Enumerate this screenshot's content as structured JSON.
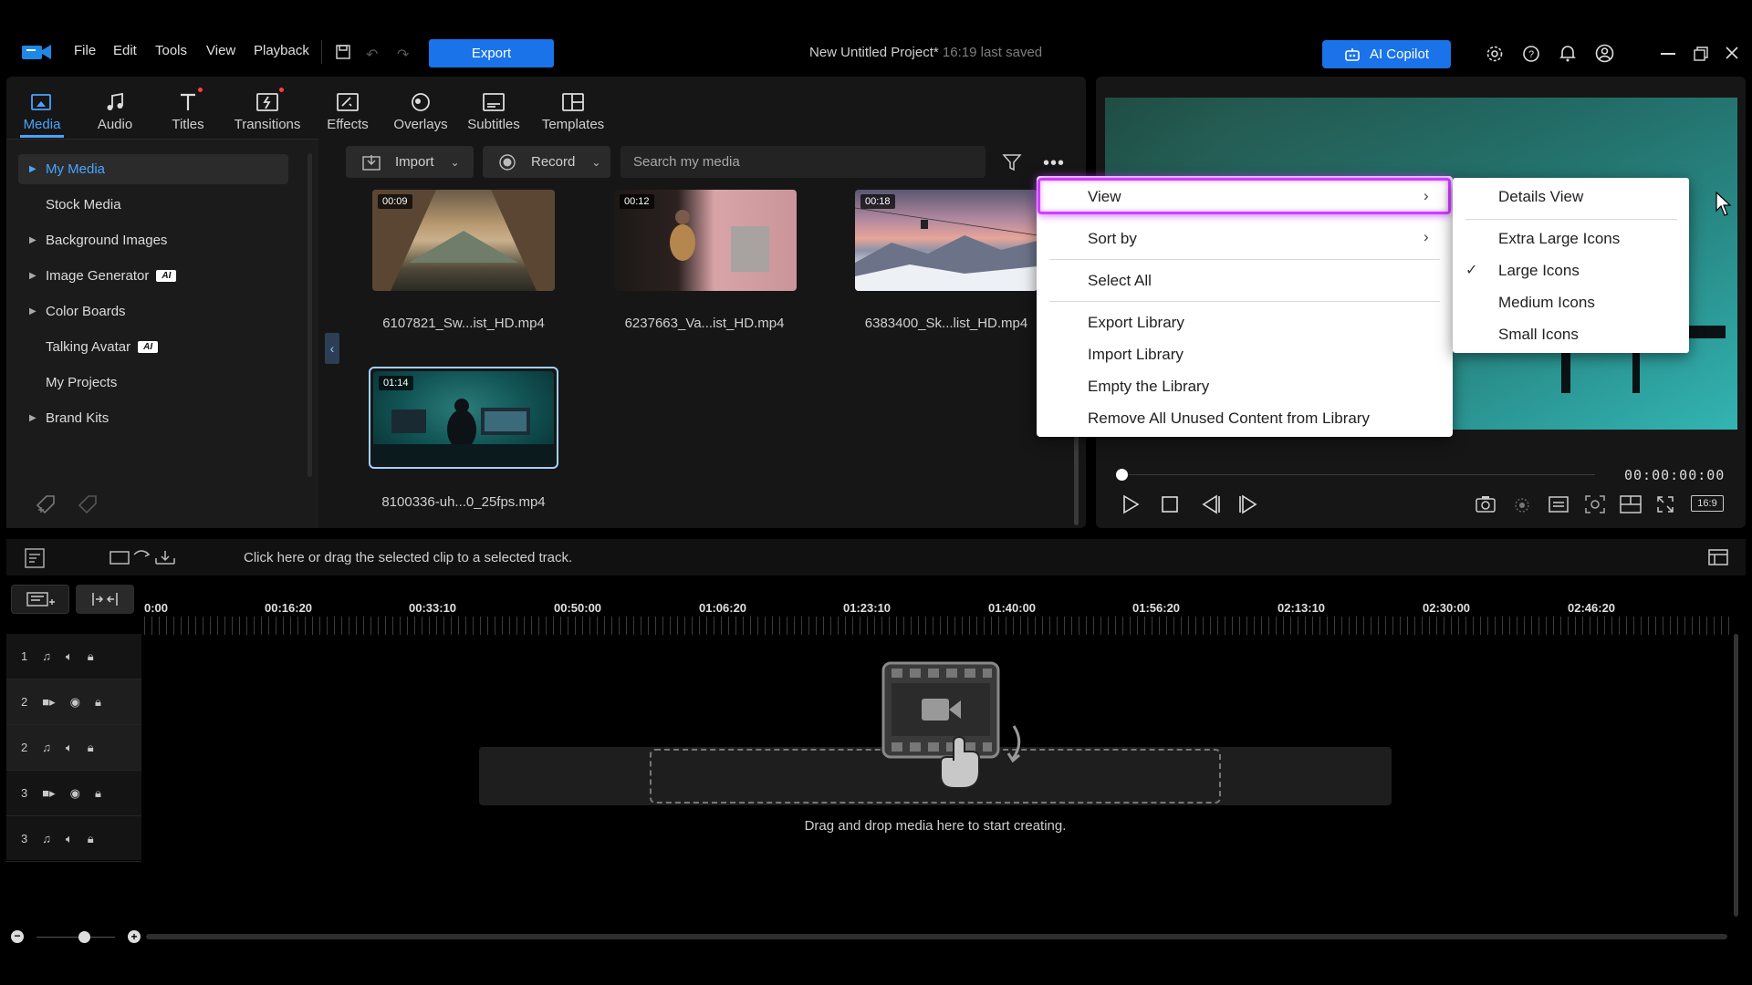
{
  "menubar": {
    "items": [
      "File",
      "Edit",
      "Tools",
      "View",
      "Playback"
    ],
    "export_label": "Export",
    "project_title": "New Untitled Project*",
    "last_saved": "16:19 last saved",
    "copilot_label": "AI Copilot"
  },
  "tabs": [
    {
      "label": "Media",
      "icon": "media-icon",
      "active": true
    },
    {
      "label": "Audio",
      "icon": "music-note-icon"
    },
    {
      "label": "Titles",
      "icon": "title-t-icon",
      "badge": true
    },
    {
      "label": "Transitions",
      "icon": "transition-icon",
      "badge": true
    },
    {
      "label": "Effects",
      "icon": "effects-icon"
    },
    {
      "label": "Overlays",
      "icon": "overlays-icon"
    },
    {
      "label": "Subtitles",
      "icon": "subtitles-icon"
    },
    {
      "label": "Templates",
      "icon": "templates-icon"
    }
  ],
  "sidebar": {
    "items": [
      {
        "label": "My Media",
        "caret": true,
        "selected": true
      },
      {
        "label": "Stock Media"
      },
      {
        "label": "Background Images",
        "caret": true
      },
      {
        "label": "Image Generator",
        "caret": true,
        "ai": "AI"
      },
      {
        "label": "Color Boards",
        "caret": true
      },
      {
        "label": "Talking Avatar",
        "ai": "AI"
      },
      {
        "label": "My Projects"
      },
      {
        "label": "Brand Kits",
        "caret": true
      }
    ]
  },
  "toolbar": {
    "import_label": "Import",
    "record_label": "Record",
    "search_placeholder": "Search my media"
  },
  "media": [
    {
      "name": "6107821_Sw...ist_HD.mp4",
      "duration": "00:09"
    },
    {
      "name": "6237663_Va...ist_HD.mp4",
      "duration": "00:12"
    },
    {
      "name": "6383400_Sk...list_HD.mp4",
      "duration": "00:18"
    },
    {
      "name": "8100336-uh...0_25fps.mp4",
      "duration": "01:14"
    }
  ],
  "context_menu": {
    "items": [
      "View",
      "Sort by",
      "Select All",
      "Export Library",
      "Import Library",
      "Empty the Library",
      "Remove All Unused Content from Library"
    ],
    "submenu": [
      "Details View",
      "Extra Large Icons",
      "Large Icons",
      "Medium Icons",
      "Small Icons"
    ],
    "checked": "Large Icons"
  },
  "preview": {
    "timecode": "00:00:00:00",
    "aspect": "16:9"
  },
  "timeline": {
    "hint": "Click here or drag the selected clip to a selected track.",
    "ruler": [
      "0:00",
      "00:16:20",
      "00:33:10",
      "00:50:00",
      "01:06:20",
      "01:23:10",
      "01:40:00",
      "01:56:20",
      "02:13:10",
      "02:30:00",
      "02:46:20"
    ],
    "tracks": [
      {
        "num": "1",
        "type": "audio"
      },
      {
        "num": "2",
        "type": "video"
      },
      {
        "num": "2",
        "type": "audio"
      },
      {
        "num": "3",
        "type": "video"
      },
      {
        "num": "3",
        "type": "audio"
      }
    ],
    "drop_hint": "Drag and drop media here to start creating."
  },
  "colors": {
    "accent": "#1a73e8",
    "highlight": "#d33dff",
    "active_tab": "#4aa3ff"
  }
}
